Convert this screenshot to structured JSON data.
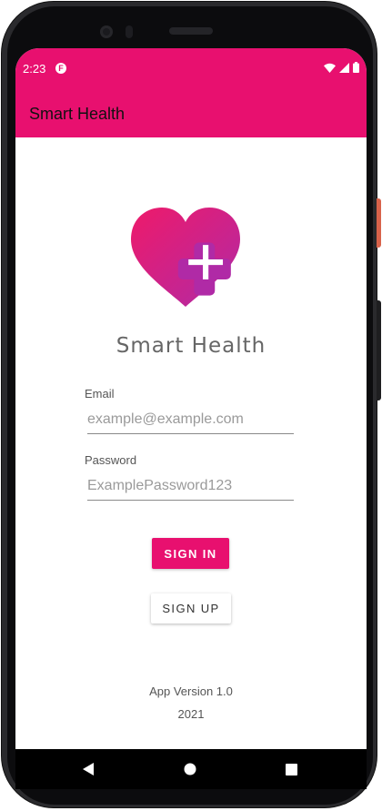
{
  "status_bar": {
    "time": "2:23",
    "app_badge": "F",
    "icons": [
      "wifi-icon",
      "signal-icon",
      "battery-icon"
    ]
  },
  "app_bar": {
    "title": "Smart Health"
  },
  "brand": {
    "name": "Smart Health",
    "logo_icon": "heart-plus-icon"
  },
  "form": {
    "email_label": "Email",
    "email_placeholder": "example@example.com",
    "email_value": "",
    "password_label": "Password",
    "password_placeholder": "ExamplePassword123",
    "password_value": "",
    "signin_label": "SIGN IN",
    "signup_label": "SIGN UP"
  },
  "footer": {
    "version": "App Version 1.0",
    "year": "2021"
  },
  "nav": {
    "icons": [
      "back-icon",
      "home-icon",
      "recents-icon"
    ]
  },
  "colors": {
    "accent": "#e8106f",
    "logo_gradient_start": "#ee1a6a",
    "logo_gradient_end": "#b02aa6",
    "text_secondary": "#555555"
  }
}
